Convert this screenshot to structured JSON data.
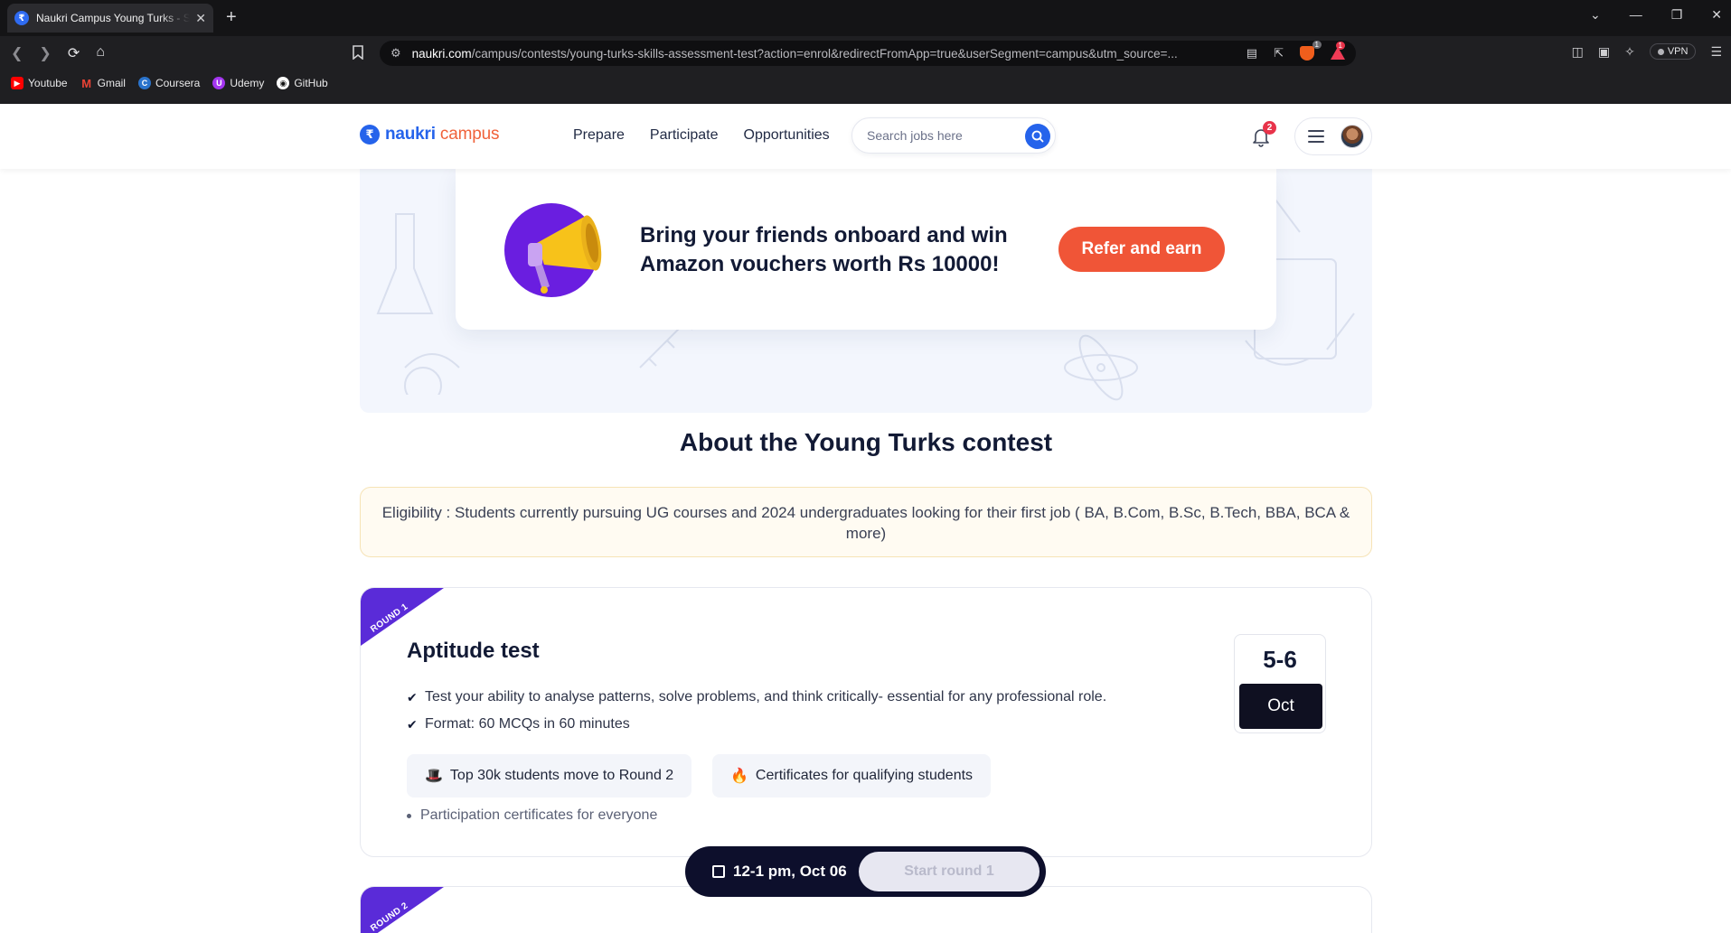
{
  "browser": {
    "tab": {
      "title": "Naukri Campus Young Turks - S",
      "favicon": "naukri-logo-icon"
    },
    "address": {
      "domain": "naukri.com",
      "path": "/campus/contests/young-turks-skills-assessment-test?action=enrol&redirectFromApp=true&userSegment=campus&utm_source=..."
    },
    "brave_badge": "1",
    "alert_badge": "1",
    "vpn_label": "VPN",
    "bookmarks": [
      {
        "label": "Youtube",
        "icon": "youtube-icon",
        "color": "#ff0000"
      },
      {
        "label": "Gmail",
        "icon": "gmail-icon",
        "color": "#ea4335"
      },
      {
        "label": "Coursera",
        "icon": "coursera-icon",
        "color": "#2a73cc"
      },
      {
        "label": "Udemy",
        "icon": "udemy-icon",
        "color": "#a435f0"
      },
      {
        "label": "GitHub",
        "icon": "github-icon",
        "color": "#ffffff"
      }
    ]
  },
  "header": {
    "logo": {
      "brand": "naukri",
      "sub": "campus"
    },
    "nav": [
      "Prepare",
      "Participate",
      "Opportunities"
    ],
    "search_placeholder": "Search jobs here",
    "notification_count": "2",
    "brand_color": "#2563eb",
    "accent_color": "#f05537"
  },
  "referral": {
    "text_line1": "Bring your friends onboard and win",
    "text_line2": "Amazon vouchers worth Rs 10000!",
    "button": "Refer and earn"
  },
  "about": {
    "title": "About the Young Turks contest",
    "eligibility": "Eligibility : Students currently pursuing UG courses and 2024 undergraduates looking for their first job ( BA, B.Com, B.Sc, B.Tech, BBA, BCA & more)"
  },
  "rounds": [
    {
      "ribbon": "ROUND 1",
      "title": "Aptitude test",
      "bullets": [
        "Test your ability to analyse patterns, solve problems, and think critically- essential for any professional role.",
        "Format: 60 MCQs in 60 minutes"
      ],
      "perks": [
        {
          "icon": "top-hat-icon",
          "glyph": "🎩",
          "label": "Top 30k students move to Round 2"
        },
        {
          "icon": "fire-icon",
          "glyph": "🔥",
          "label": "Certificates for qualifying students"
        }
      ],
      "note": "Participation certificates for everyone",
      "date_days": "5-6",
      "date_month": "Oct"
    },
    {
      "ribbon": "ROUND 2"
    }
  ],
  "start_bar": {
    "time": "12-1 pm, Oct 06",
    "button": "Start round 1"
  }
}
